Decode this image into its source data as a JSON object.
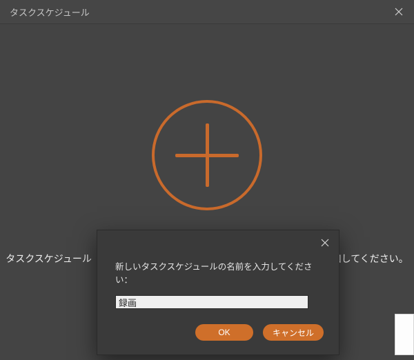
{
  "colors": {
    "accent": "#cf6f2a"
  },
  "window": {
    "title": "タスクスケジュール",
    "close_label": "Close"
  },
  "main": {
    "add_button_label": "Add task schedule",
    "hint_prefix": "タスクスケジュール",
    "hint_suffix": "を追加してください。"
  },
  "modal": {
    "close_label": "Close",
    "prompt": "新しいタスクスケジュールの名前を入力してください：",
    "input_value": "録画",
    "ok_label": "OK",
    "cancel_label": "キャンセル"
  }
}
